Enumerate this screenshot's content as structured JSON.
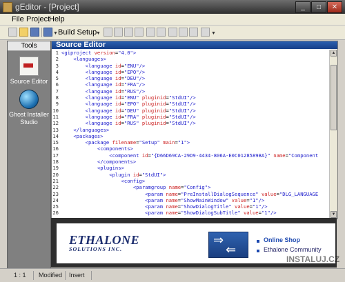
{
  "window": {
    "title": "gEditor - [Project]"
  },
  "menu": {
    "file": "File",
    "project": "Project",
    "help": "Help"
  },
  "toolbar": {
    "build_setup": "Build Setup"
  },
  "tools": {
    "header": "Tools",
    "source_editor": "Source Editor",
    "ghost_installer_1": "Ghost Installer",
    "ghost_installer_2": "Studio"
  },
  "editor": {
    "header": "Source Editor",
    "lines": [
      "<giproject version=\"4.0\">",
      "    <languages>",
      "        <language id=\"ENU\"/>",
      "        <language id=\"EPO\"/>",
      "        <language id=\"DEU\"/>",
      "        <language id=\"FRA\"/>",
      "        <language id=\"RUS\"/>",
      "        <language id=\"ENU\" pluginid=\"StdUI\"/>",
      "        <language id=\"EPO\" pluginid=\"StdUI\"/>",
      "        <language id=\"DEU\" pluginid=\"StdUI\"/>",
      "        <language id=\"FRA\" pluginid=\"StdUI\"/>",
      "        <language id=\"RUS\" pluginid=\"StdUI\"/>",
      "    </languages>",
      "    <packages>",
      "        <package filename=\"Setup\" main=\"1\">",
      "            <components>",
      "                <component id=\"{D66D69CA-29D9-4434-806A-E0C0128589BA}\" name=\"Component",
      "            </components>",
      "            <plugins>",
      "                <plugin id=\"StdUI\">",
      "                    <config>",
      "                        <paramgroup name=\"Config\">",
      "                            <param name=\"PreInstallDialogSequence\" value=\"DLG_LANGUAGE",
      "                            <param name=\"ShowMainWindow\" value=\"1\"/>",
      "                            <param name=\"ShowDialogTitle\" value=\"1\"/>",
      "                            <param name=\"ShowDialogSubTitle\" value=\"1\"/>"
    ]
  },
  "banner": {
    "logo_line1": "ETHALONE",
    "logo_line2": "SOLUTIONS INC.",
    "link1": "Online Shop",
    "link2": "Ethalone Community"
  },
  "status": {
    "position": "1 : 1",
    "modified": "Modified",
    "mode": "Insert"
  },
  "watermark": "INSTALUJ.CZ"
}
